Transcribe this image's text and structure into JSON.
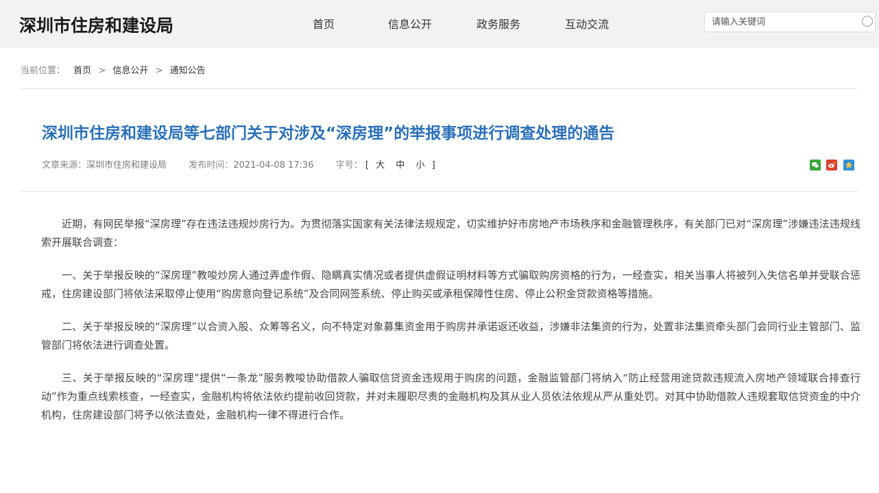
{
  "header": {
    "site_name": "深圳市住房和建设局",
    "nav": [
      {
        "label": "首页"
      },
      {
        "label": "信息公开"
      },
      {
        "label": "政务服务"
      },
      {
        "label": "互动交流"
      }
    ],
    "search": {
      "placeholder": "请输入关键词"
    }
  },
  "breadcrumb": {
    "prefix": "当前位置：",
    "items": [
      "首页",
      "信息公开",
      "通知公告"
    ],
    "separator": ">"
  },
  "article": {
    "title": "深圳市住房和建设局等七部门关于对涉及“深房理”的举报事项进行调查处理的通告",
    "meta": {
      "source_label": "文章来源：",
      "source": "深圳市住房和建设局",
      "date_label": "发布时间：",
      "date": "2021-04-08 17:36",
      "font_label": "字号：",
      "font_open": "[",
      "font_sizes": [
        "大",
        "中",
        "小"
      ],
      "font_close": "]"
    },
    "share_icons": [
      "wechat-icon",
      "weibo-icon",
      "qzone-icon"
    ],
    "paragraphs": [
      "近期，有网民举报“深房理”存在违法违规炒房行为。为贯彻落实国家有关法律法规规定，切实维护好市房地产市场秩序和金融管理秩序，有关部门已对“深房理”涉嫌违法违规线索开展联合调查：",
      "一、关于举报反映的“深房理”教唆炒房人通过弄虚作假、隐瞒真实情况或者提供虚假证明材料等方式骗取购房资格的行为，一经查实，相关当事人将被列入失信名单并受联合惩戒，住房建设部门将依法采取停止使用“购房意向登记系统”及合同网签系统、停止购买或承租保障性住房、停止公积金贷款资格等措施。",
      "二、关于举报反映的“深房理”以合资入股、众筹等名义，向不特定对象募集资金用于购房并承诺返还收益，涉嫌非法集资的行为，处置非法集资牵头部门会同行业主管部门、监管部门将依法进行调查处置。",
      "三、关于举报反映的“深房理”提供“一条龙”服务教唆协助借款人骗取信贷资金违规用于购房的问题，金融监管部门将纳入“防止经营用途贷款违规流入房地产领域联合排查行动”作为重点线索核查，一经查实，金融机构将依法依约提前收回贷款，并对未履职尽责的金融机构及其从业人员依法依规从严从重处罚。对其中协助借款人违规套取信贷资金的中介机构，住房建设部门将予以依法查处，金融机构一律不得进行合作。"
    ]
  },
  "colors": {
    "header_bg": "#f2f2f2",
    "title": "#2a6fb8",
    "wechat": "#3aa53a",
    "weibo": "#d9402c",
    "qzone": "#2f8fd8"
  }
}
